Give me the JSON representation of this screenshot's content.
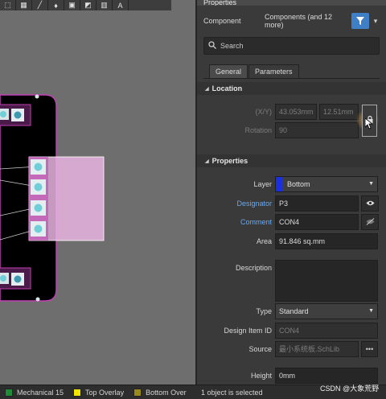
{
  "toolbar": {
    "icons": [
      "route-icon",
      "align-icon",
      "line-icon",
      "pad-icon",
      "fill-icon",
      "text-icon",
      "delete-icon",
      "dimension-icon"
    ],
    "glyphs": [
      "⬚",
      "▦",
      "╱",
      "♦",
      "▣",
      "◩",
      "▥",
      "A"
    ]
  },
  "panel": {
    "title": "Properties",
    "filter_key": "Component",
    "filter_value": "Components (and 12 more)",
    "search_placeholder": "Search",
    "tabs": [
      "General",
      "Parameters"
    ]
  },
  "location": {
    "section": "Location",
    "xy_label": "(X/Y)",
    "x_value": "43.053mm",
    "y_value": "12.51mm",
    "rotation_label": "Rotation",
    "rotation_value": "90"
  },
  "properties": {
    "section": "Properties",
    "layer_label": "Layer",
    "layer_value": "Bottom",
    "layer_color": "#1a2fe0",
    "designator_label": "Designator",
    "designator_value": "P3",
    "comment_label": "Comment",
    "comment_value": "CON4",
    "area_label": "Area",
    "area_value": "91.846 sq.mm",
    "description_label": "Description",
    "description_value": "",
    "type_label": "Type",
    "type_value": "Standard",
    "design_item_label": "Design Item ID",
    "design_item_value": "CON4",
    "source_label": "Source",
    "source_value": "最小系统板.SchLib",
    "more_label": "•••",
    "height_label": "Height",
    "height_value": "0mm"
  },
  "statusbar": {
    "layers": [
      {
        "name": "Mechanical 15",
        "color": "#1f8a3a"
      },
      {
        "name": "Top Overlay",
        "color": "#f2e600"
      },
      {
        "name": "Bottom Over",
        "color": "#9a8a16"
      }
    ],
    "message": "1 object is selected"
  },
  "watermark": "CSDN @大象荒野",
  "colors": {
    "accent": "#3f7fc6",
    "link_blue": "#6aa8ef",
    "board": "#000000",
    "silk_magenta": "#c23fb3",
    "selection_pink": "#e9b4e3",
    "pad_cyan": "#6ecfd8"
  }
}
